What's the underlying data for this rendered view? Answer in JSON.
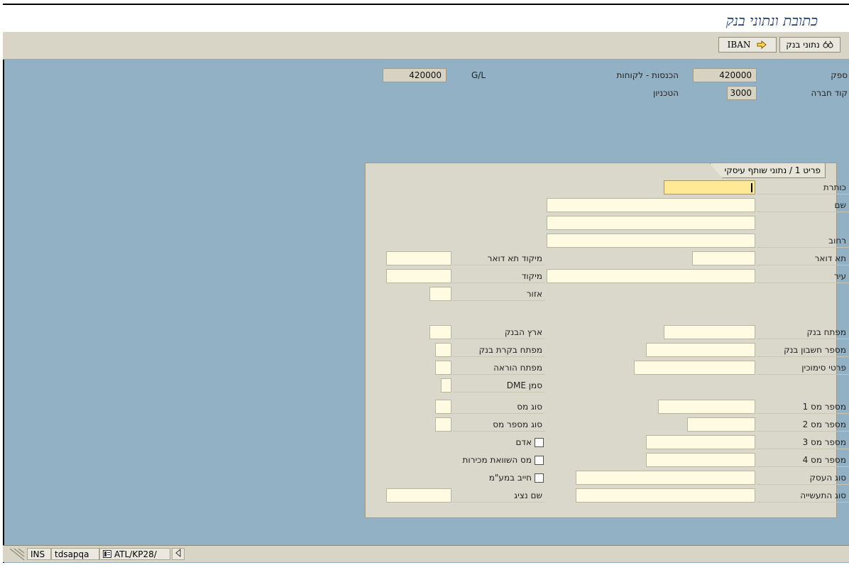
{
  "window": {
    "title": "כתובת ונתוני בנק"
  },
  "toolbar": {
    "bank_data_label": "נתוני בנק",
    "iban_label": "IBAN"
  },
  "header": {
    "vendor_label": "ספק",
    "vendor_value": "420000",
    "vendor_desc": "הכנסות - לקוחות",
    "gl_label": "G/L",
    "gl_value": "420000",
    "company_label": "קוד חברה",
    "company_value": "3000",
    "company_desc": "הטכניון"
  },
  "panel": {
    "tab_label": "פריט 1 / נתוני שותף עיסקי"
  },
  "right_fields": {
    "title": "כותרת",
    "name": "שם",
    "street": "רחוב",
    "po_box": "תא דואר",
    "city": "עיר",
    "bank_key": "מפתח בנק",
    "bank_account": "מספר חשבון בנק",
    "reference": "פרטי סימוכין",
    "tax1": "מספר מס 1",
    "tax2": "מספר מס 2",
    "tax3": "מספר מס 3",
    "tax4": "מספר מס 4",
    "business_type": "סוג העסק",
    "industry_type": "סוג התעשייה"
  },
  "left_fields": {
    "po_box_zip": "מיקוד תא דואר",
    "zip": "מיקוד",
    "region": "אזור",
    "bank_country": "ארץ הבנק",
    "bank_control": "מפתח בקרת בנק",
    "instruction_key": "מפתח הוראה",
    "dme_indicator": "סמן DME",
    "tax_type": "סוג מס",
    "tax_number_type": "סוג מספר מס",
    "person": "אדם",
    "sales_equalization_tax": "מס השוואת מכירות",
    "vat_liable": "חייב במע\"מ",
    "representative_name": "שם נציג"
  },
  "statusbar": {
    "mode": "INS",
    "server": "tdsapqa",
    "session": "ATL/KP28/"
  },
  "colors": {
    "background": "#93b1c5",
    "title": "#1f3f7a",
    "input": "#fffbe2",
    "focus": "#ffe896"
  }
}
